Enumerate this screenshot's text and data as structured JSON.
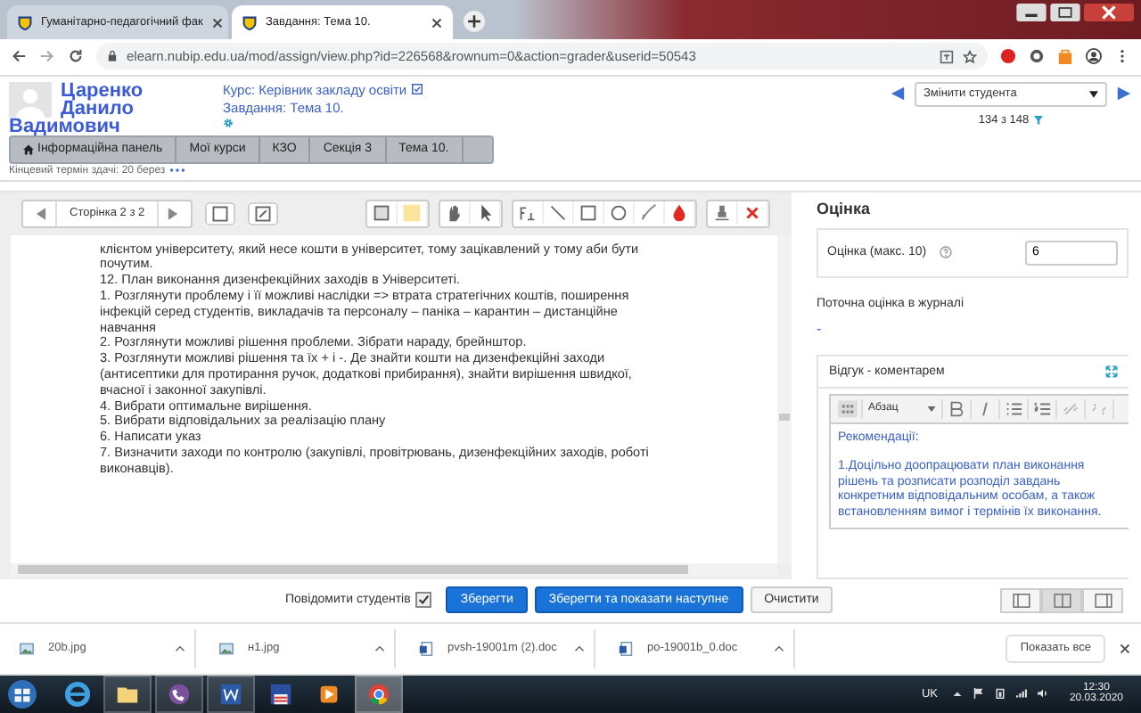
{
  "browser": {
    "tabs": [
      {
        "title": "Гуманітарно-педагогічний фак",
        "selected": false
      },
      {
        "title": "Завдання: Тема 10.",
        "selected": true
      }
    ],
    "url": "elearn.nubip.edu.ua/mod/assign/view.php?id=226568&rownum=0&action=grader&userid=50543"
  },
  "student": {
    "name": "Царенко Данило Вадимович",
    "course": "Курс: Керівник закладу освіти",
    "assignment": "Завдання: Тема 10.",
    "select_placeholder": "Змінити студента",
    "counter": "134 з 148"
  },
  "breadcrumb": [
    {
      "label": "Інформаційна панель",
      "kind": "home"
    },
    {
      "label": "Мої курси",
      "kind": "link"
    },
    {
      "label": "КЗО",
      "kind": "link"
    },
    {
      "label": "Секція 3",
      "kind": "link"
    },
    {
      "label": "Тема 10.",
      "kind": "link"
    }
  ],
  "due": "Кінцевий термін здачі: 20 берез",
  "pdf_toolbar": {
    "page": "Сторінка 2 з 2"
  },
  "document_paragraphs": [
    "клієнтом університету, який несе кошти в університет, тому зацікавлений у тому аби бути почутим.",
    "12. План виконання дизенфекційних заходів в Університеті.",
    "1. Розглянути проблему і її можливі наслідки => втрата стратегічних коштів, поширення інфекцій серед студентів, викладачів та персоналу – паніка – карантин – дистанційне навчання",
    "2. Розглянути можливі рішення проблеми. Зібрати нараду, брейнштор.",
    "3. Розглянути можливі рішення та їх + і -. Де знайти кошти на дизенфекційні заходи (антисептики для протирання ручок, додаткові прибирання), знайти вирішення швидкої, вчасної і законної закупівлі.",
    "4. Вибрати оптимальне вирішення.",
    "5. Вибрати відповідальних за реалізацію плану",
    "6. Написати указ",
    "7. Визначити заходи по контролю (закупівлі, провітрювань, дизенфекційних заходів, роботі виконавців)."
  ],
  "notify": {
    "label": "Повідомити студентів",
    "checked": true
  },
  "buttons": [
    {
      "label": "Зберегти",
      "kind": "primary"
    },
    {
      "label": "Зберегти та показати наступне",
      "kind": "primary"
    },
    {
      "label": "Очистити",
      "kind": "default"
    }
  ],
  "layout_modes": [
    {
      "selected": false
    },
    {
      "selected": true
    },
    {
      "selected": false
    }
  ],
  "grade": {
    "heading": "Оцінка",
    "label": "Оцінка (макс. 10)",
    "value": "6",
    "current_label": "Поточна оцінка в журналі",
    "current_value": "-"
  },
  "feedback": {
    "title": "Відгук - коментарем",
    "format": "Абзац",
    "heading": "Рекомендації:",
    "text": "1.Доцільно доопрацювати план виконання рішень та розписати розподіл завдань конкретним відповідальним особам, а також встановленням вимог і термінів їх виконання."
  },
  "downloads": {
    "files": [
      {
        "name": "20b.jpg",
        "kind": "image"
      },
      {
        "name": "н1.jpg",
        "kind": "image"
      },
      {
        "name": "pvsh-19001m (2).doc",
        "kind": "doc"
      },
      {
        "name": "po-19001b_0.doc",
        "kind": "doc"
      }
    ],
    "show_all": "Показать все"
  },
  "taskbar": {
    "language": "UK",
    "time": "12:30",
    "date": "20.03.2020"
  }
}
